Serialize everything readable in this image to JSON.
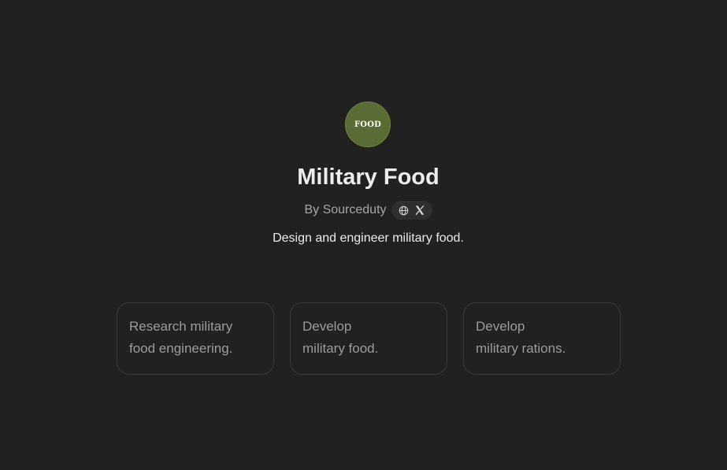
{
  "gpt": {
    "avatar_text": "FOOD",
    "title": "Military Food",
    "byline": "By Sourceduty",
    "description": "Design and engineer military food.",
    "social_icons": [
      "globe-icon",
      "x-logo-icon"
    ]
  },
  "conversation_starters": [
    {
      "line1": "Research military",
      "line2": "food engineering."
    },
    {
      "line1": "Develop",
      "line2": "military food."
    },
    {
      "line1": "Develop",
      "line2": "military rations."
    }
  ],
  "colors": {
    "background": "#212121",
    "avatar_bg": "#5a6b33",
    "title": "#ececec",
    "muted_text": "#a6a6a6",
    "card_border": "#3a3a3a"
  }
}
